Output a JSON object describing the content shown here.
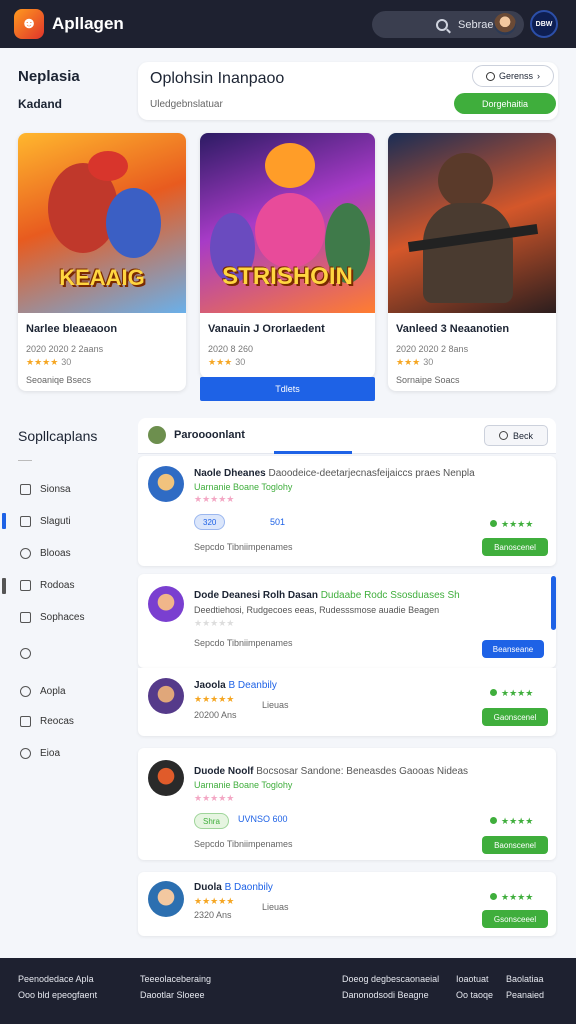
{
  "topbar": {
    "logo_glyph": "☻",
    "app_name": "Apllagen",
    "search_text": "Sebrae",
    "badge_text": "DBW"
  },
  "left_header": {
    "title": "Neplasia",
    "subtitle": "Kadand"
  },
  "hero": {
    "title": "Oplohsin Inanpaoo",
    "subtitle": "Uledgebnslatuar",
    "genre_label": "Gerenss",
    "action_label": "Dorgehaitia"
  },
  "games": [
    {
      "art_text": "KEAAIG",
      "title": "Narlee bleaeaoon",
      "meta": "2020 2020 2 2aans",
      "stars": "★★★★",
      "rating": "30",
      "sub": "Seoaniqe Bsecs"
    },
    {
      "art_text": "STRISHOIN",
      "title": "Vanauin J Ororlaedent",
      "meta": "2020 8 260",
      "stars": "★★★",
      "rating": "30",
      "sub": "",
      "button": "Tdlets"
    },
    {
      "art_text": "",
      "title": "Vanleed 3 Neaanotien",
      "meta": "2020 2020 2 8ans",
      "stars": "★★★",
      "rating": "30",
      "sub": "Sornaipe Soacs"
    }
  ],
  "sidebar": {
    "heading": "Sopllcaplans",
    "items": [
      {
        "label": "Sionsa",
        "icon": "image-icon"
      },
      {
        "label": "Slaguti",
        "icon": "square-icon"
      },
      {
        "label": "Blooas",
        "icon": "chat-icon"
      },
      {
        "label": "Rodoas",
        "icon": "box-icon"
      },
      {
        "label": "Sophaces",
        "icon": "frame-icon"
      },
      {
        "label": "",
        "icon": "settings-icon"
      },
      {
        "label": "Aopla",
        "icon": "clock-icon"
      },
      {
        "label": "Reocas",
        "icon": "grid-icon"
      },
      {
        "label": "Eioa",
        "icon": "info-icon"
      }
    ]
  },
  "reviews_panel": {
    "title": "Paroooonlant",
    "back_label": "Beck"
  },
  "reviews": [
    {
      "name": "Naole Dheanes",
      "body1": "Daoodeice-deetarjecnasfeijaiccs praes Nenpla",
      "body2": "Uarnanie Boane Toglohy",
      "stars": "★★★★★",
      "pill": "320",
      "pill_extra": "501",
      "foot": "Sepcdo  Tibniimpenames",
      "grate": "★★★★",
      "button": "Banoscenel"
    },
    {
      "name": "Dode Deanesi Rolh Dasan",
      "body1": "Dudaabe Rodc  Ssosduases Sh",
      "body2": "Deedtiehosi, Rudgecoes eeas, Rudesssmose  auadie  Beagen",
      "stars": "★★★★★",
      "foot": "Sepcdo  Tibniimpenames",
      "button": "Beanseane"
    },
    {
      "name": "Jaoola",
      "byline": "B Deanbily",
      "stars": "★★★★★",
      "year": "20200 Ans",
      "center": "Lieuas",
      "grate": "★★★★",
      "button": "Gaonscenel"
    },
    {
      "name": "Duode Noolf",
      "body1": "Bocsosar  Sandone: Beneasdes  Gaooas Nideas",
      "body2": "Uarnanie Boane Toglohy",
      "stars": "★★★★★",
      "pill": "Shra",
      "pill_extra": "UVNSO 600",
      "foot": "Sepcdo  Tibniimpenames",
      "grate": "★★★★",
      "button": "Baonscenel"
    },
    {
      "name": "Duola",
      "byline": "B Daonbily",
      "stars": "★★★★★",
      "year": "2320 Ans",
      "center": "Lieuas",
      "grate": "★★★★",
      "button": "Gsonsceeel"
    }
  ],
  "footer": {
    "col1a": "Peenodedace Apla",
    "col1b": "Ooo bld epeogfaent",
    "col2a": "Teeeolaceberaing",
    "col2b": "Daootlar Sloeee",
    "col3a": "Doeog degbescaonaeial",
    "col3b": "Danonodsodi Beagne",
    "col4a": "Ioaotuat",
    "col4b": "Oo taoqe",
    "col5a": "Baolatiaa",
    "col5b": "Peanaied"
  }
}
